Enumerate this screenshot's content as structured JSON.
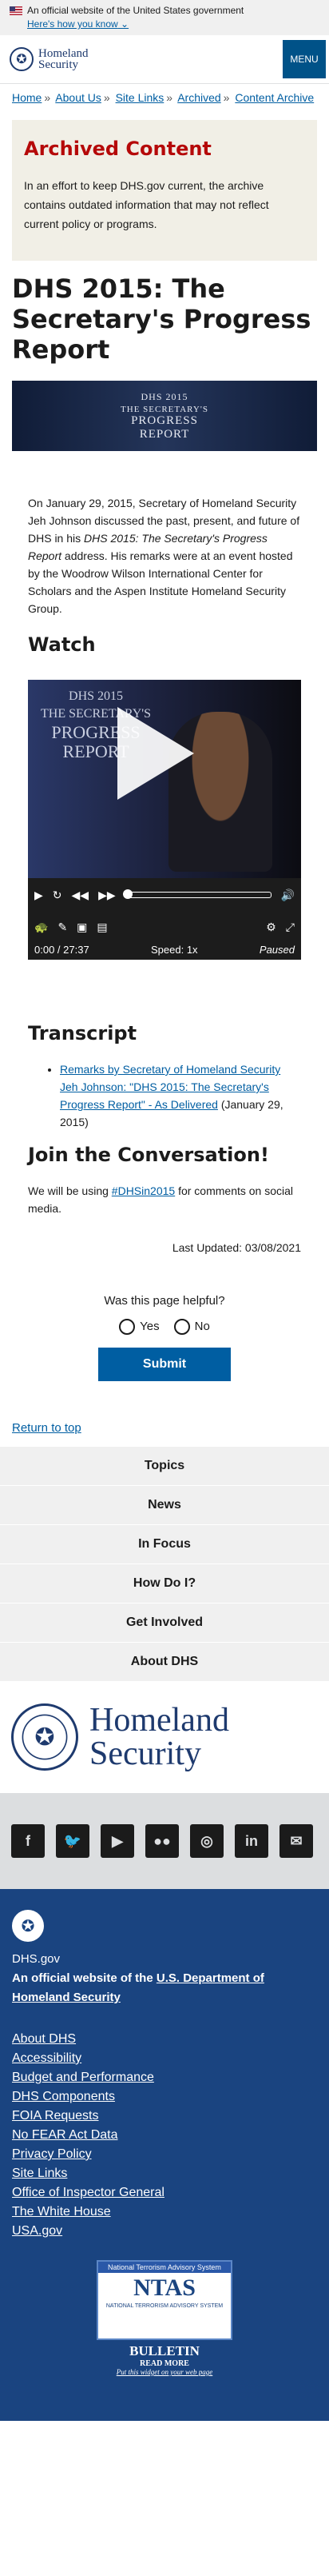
{
  "banner": {
    "text": "An official website of the United States government",
    "how": "Here's how you know"
  },
  "header": {
    "logo_line1": "Homeland",
    "logo_line2": "Security",
    "menu": "MENU"
  },
  "breadcrumbs": [
    "Home",
    "About Us",
    "Site Links",
    "Archived",
    "Content Archive"
  ],
  "archived": {
    "title": "Archived Content",
    "body": "In an effort to keep DHS.gov current, the archive contains outdated information that may not reflect current policy or programs."
  },
  "page": {
    "title": "DHS 2015: The Secretary's Progress Report"
  },
  "hero": {
    "line1": "DHS 2015",
    "line2": "THE SECRETARY'S",
    "line3": "PROGRESS",
    "line4": "REPORT"
  },
  "intro": {
    "p1": "On January 29, 2015, Secretary of Homeland Security Jeh Johnson discussed the past, present, and future of DHS in his ",
    "em": "DHS 2015: The Secretary's Progress Report",
    "p2": " address.  His remarks were at an event hosted by the Woodrow Wilson International Center for Scholars and the Aspen Institute Homeland Security Group."
  },
  "watch": {
    "heading": "Watch",
    "time": "0:00 / 27:37",
    "speed": "Speed: 1x",
    "status": "Paused",
    "progress": 0
  },
  "transcript": {
    "heading": "Transcript",
    "link": "Remarks by Secretary of Homeland Security Jeh Johnson: \"DHS 2015: The Secretary's Progress Report\" - As Delivered",
    "date": " (January 29, 2015)"
  },
  "conversation": {
    "heading": "Join the Conversation!",
    "pre": "We will be using ",
    "tag": "#DHSin2015",
    "post": " for comments on social media."
  },
  "updated": "Last Updated: 03/08/2021",
  "feedback": {
    "question": "Was this page helpful?",
    "yes": "Yes",
    "no": "No",
    "submit": "Submit"
  },
  "return_top": "Return to top",
  "nav": [
    "Topics",
    "News",
    "In Focus",
    "How Do I?",
    "Get Involved",
    "About DHS"
  ],
  "brand": {
    "line1": "Homeland",
    "line2": "Security"
  },
  "social": [
    "f",
    "t",
    "yt",
    "fl",
    "ig",
    "in",
    "mail"
  ],
  "footer": {
    "site": "DHS.gov",
    "official_pre": "An official website of the ",
    "official_link": "U.S. Department of Homeland Security",
    "links": [
      "About DHS",
      "Accessibility",
      "Budget and Performance",
      "DHS Components",
      "FOIA Requests",
      "No FEAR Act Data",
      "Privacy Policy",
      "Site Links",
      "Office of Inspector General",
      "The White House",
      "USA.gov"
    ]
  },
  "ntas": {
    "header": "National Terrorism Advisory System",
    "logo": "NTAS",
    "sub": "NATIONAL TERRORISM ADVISORY SYSTEM",
    "bulletin": "BULLETIN",
    "read_more": "READ MORE",
    "widget": "Put this widget on your web page"
  }
}
